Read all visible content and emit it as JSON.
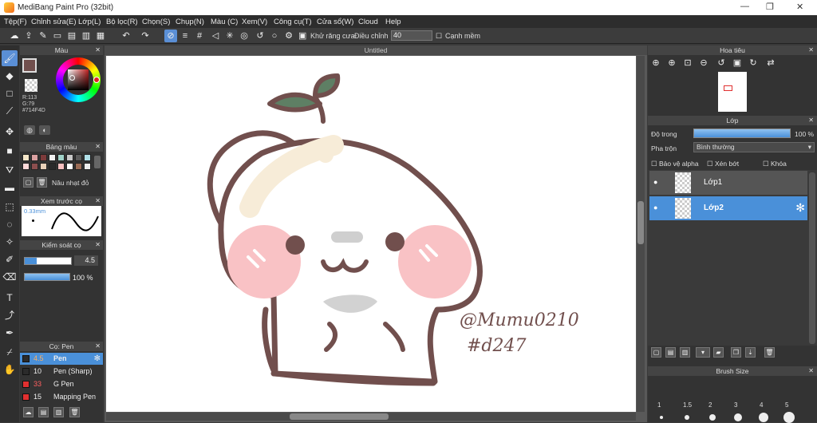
{
  "window": {
    "title": "MediBang Paint Pro (32bit)"
  },
  "menu": [
    "Tệp(F)",
    "Chỉnh sửa(E)",
    "Lớp(L)",
    "Bộ lọc(R)",
    "Chọn(S)",
    "Chụp(N)",
    "Màu (C)",
    "Xem(V)",
    "Công cụ(T)",
    "Cửa sổ(W)",
    "Cloud",
    "Help"
  ],
  "toolbar": {
    "antialias_label": "Khử răng cưa",
    "adjust_label": "Điều chỉnh",
    "adjust_value": "40",
    "smooth_label": "Cạnh mềm"
  },
  "color_panel": {
    "title": "Màu",
    "r": "R:113",
    "g": "G:79",
    "hex": "#714F4D",
    "main_color": "#714F4D"
  },
  "palette_panel": {
    "title": "Bảng màu",
    "button_label": "Nâu nhạt đỏ",
    "colors": [
      "#f5e6c8",
      "#d9a0a0",
      "#7d3b3b",
      "#f2f2f2",
      "#a0d2c8",
      "#c8c8c8",
      "#5a5a5a",
      "#b0e0e8",
      "#ffd8d8",
      "#8b4e4e",
      "#e8d0b8",
      "#2a2a2a",
      "#f7c0c0",
      "#ffffff",
      "#9a6b55",
      "#ededed"
    ]
  },
  "preview_panel": {
    "title": "Xem trước cọ",
    "size": "0.33mm"
  },
  "control_panel": {
    "title": "Kiểm soát cọ",
    "size_value": "4.5",
    "opacity_value": "100 %",
    "size_fraction": 0.25,
    "opacity_fraction": 1.0
  },
  "brush_panel": {
    "title": "Cọ: Pen",
    "items": [
      {
        "size": "4.5",
        "name": "Pen",
        "color": "#2b2b2b"
      },
      {
        "size": "10",
        "name": "Pen (Sharp)",
        "color": "#2b2b2b"
      },
      {
        "size": "33",
        "name": "G Pen",
        "color": "#e03030"
      },
      {
        "size": "15",
        "name": "Mapping Pen",
        "color": "#e03030"
      }
    ]
  },
  "document": {
    "title": "Untitled"
  },
  "artwork": {
    "signature_line1": "@Mumu0210",
    "signature_line2": "#d247"
  },
  "navigator": {
    "title": "Hoa tiêu"
  },
  "layer_panel": {
    "title": "Lớp",
    "opacity_label": "Độ trong",
    "opacity_value": "100 %",
    "opacity_fraction": 1.0,
    "blend_label": "Pha trộn",
    "blend_value": "Bình thường",
    "protect_alpha": "Bảo vệ alpha",
    "clipping": "Xén bớt",
    "lock": "Khóa",
    "layers": [
      {
        "name": "Lớp1"
      },
      {
        "name": "Lớp2"
      }
    ]
  },
  "brush_size_panel": {
    "title": "Brush Size",
    "sizes": [
      "1",
      "1.5",
      "2",
      "3",
      "4",
      "5"
    ]
  }
}
